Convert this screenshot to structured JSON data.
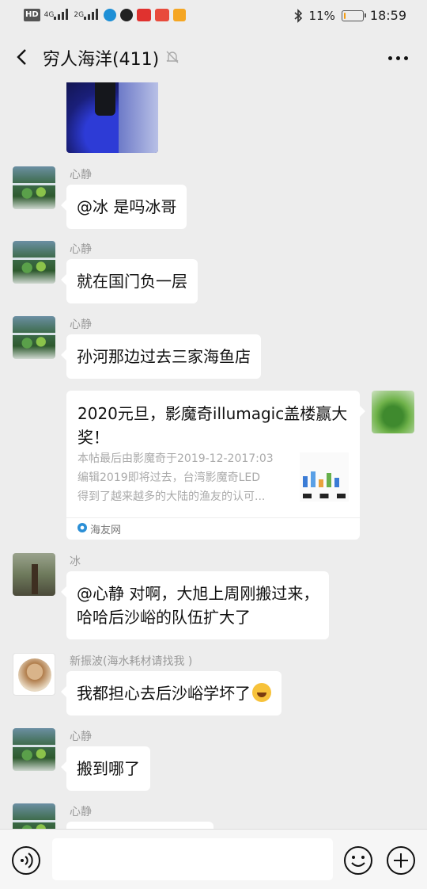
{
  "status_bar": {
    "left_icons": [
      "hd-icon",
      "4g-signal-icon",
      "2g-signal-icon",
      "tiktok-icon",
      "qq-icon",
      "app-icon-red",
      "news-icon",
      "shield-icon"
    ],
    "net_label_1": "4G",
    "net_label_2": "2G",
    "hd_label": "HD",
    "bluetooth_icon": "bluetooth-icon",
    "battery_percent": "11%",
    "time": "18:59",
    "battery_level": 0.11,
    "battery_color": "#f39c12"
  },
  "nav": {
    "title": "穷人海洋(411)",
    "back_icon": "chevron-left-icon",
    "mute_icon": "bell-off-icon",
    "more_icon": "more-dots-icon"
  },
  "messages": [
    {
      "type": "image",
      "sender": "",
      "description_icon": "image-thumbnail"
    },
    {
      "type": "text",
      "sender": "心静",
      "text": "@冰  是吗冰哥"
    },
    {
      "type": "text",
      "sender": "心静",
      "text": "就在国门负一层"
    },
    {
      "type": "text",
      "sender": "心静",
      "text": "孙河那边过去三家海鱼店"
    },
    {
      "type": "link_card",
      "outgoing": true,
      "title": "2020元旦，影魔奇illumagic盖楼赢大奖！",
      "desc_lines": [
        "本帖最后由影魔奇于2019-12-2017:03",
        "编辑2019即将过去，台湾影魔奇LED",
        "得到了越来越多的大陆的渔友的认可..."
      ],
      "source": "海友网"
    },
    {
      "type": "text",
      "sender": "冰",
      "lines": [
        "@心静 对啊，大旭上周刚搬过来，",
        "哈哈后沙峪的队伍扩大了"
      ]
    },
    {
      "type": "text",
      "sender": "新振波(海水耗材请找我 )",
      "text": "我都担心去后沙峪学坏了",
      "emoji": "crying-laughing-emoji"
    },
    {
      "type": "text",
      "sender": "心静",
      "text": "搬到哪了"
    },
    {
      "type": "text",
      "sender": "心静",
      "text": ""
    }
  ],
  "input_bar": {
    "voice_icon": "voice-icon",
    "input_value": "",
    "emoji_icon": "smiley-icon",
    "plus_icon": "plus-circle-icon"
  },
  "colors": {
    "background": "#ededed",
    "bubble": "#ffffff",
    "sender_gray": "#999999",
    "link_desc_gray": "#aaaaaa"
  }
}
